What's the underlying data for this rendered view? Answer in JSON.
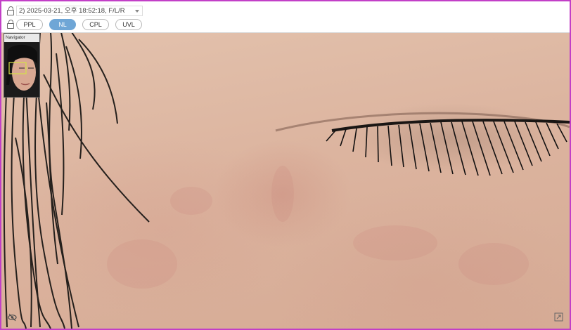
{
  "toolbar": {
    "session": "2) 2025-03-21, 오후 18:52:18, F/L/R",
    "modes": [
      "PPL",
      "NL",
      "CPL",
      "UVL"
    ],
    "active_mode": "NL",
    "icons": [
      "lock-icon",
      "lock-icon"
    ]
  },
  "navigator": {
    "title": "Navigator"
  },
  "viewer": {
    "bottom_left_icon": "eye-toggle-icon",
    "bottom_right_icon": "expand-icon"
  },
  "colors": {
    "frame_border": "#c23fc7",
    "active_mode": "#6fa6d6",
    "skin": "#dcb49f"
  }
}
